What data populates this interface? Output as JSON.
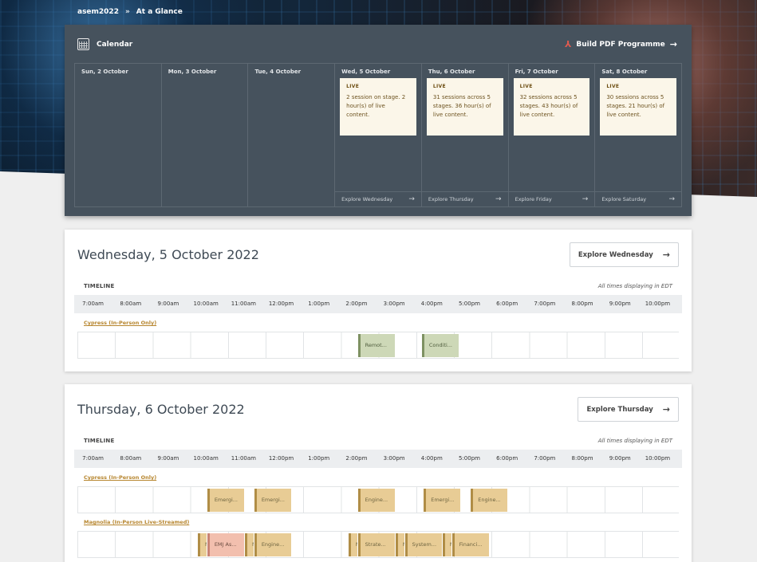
{
  "breadcrumb": {
    "root": "asem2022",
    "separator": "»",
    "current": "At a Glance"
  },
  "calendar": {
    "title": "Calendar",
    "pdf_button": "Build PDF Programme",
    "days": [
      {
        "label": "Sun, 2 October",
        "live": "",
        "desc": "",
        "explore": ""
      },
      {
        "label": "Mon, 3 October",
        "live": "",
        "desc": "",
        "explore": ""
      },
      {
        "label": "Tue, 4 October",
        "live": "",
        "desc": "",
        "explore": ""
      },
      {
        "label": "Wed, 5 October",
        "live": "LIVE",
        "desc": "2 session on stage. 2 hour(s) of live content.",
        "explore": "Explore Wednesday"
      },
      {
        "label": "Thu, 6 October",
        "live": "LIVE",
        "desc": "31 sessions across 5 stages. 36 hour(s) of live content.",
        "explore": "Explore Thursday"
      },
      {
        "label": "Fri, 7 October",
        "live": "LIVE",
        "desc": "32 sessions across 5 stages. 43 hour(s) of live content.",
        "explore": "Explore Friday"
      },
      {
        "label": "Sat, 8 October",
        "live": "LIVE",
        "desc": "30 sessions across 5 stages. 21 hour(s) of live content.",
        "explore": "Explore Saturday"
      }
    ]
  },
  "hours": [
    "7:00am",
    "8:00am",
    "9:00am",
    "10:00am",
    "11:00am",
    "12:00pm",
    "1:00pm",
    "2:00pm",
    "3:00pm",
    "4:00pm",
    "5:00pm",
    "6:00pm",
    "7:00pm",
    "8:00pm",
    "9:00pm",
    "10:00pm"
  ],
  "timeline_label": "TIMELINE",
  "timezone_note": "All times displaying in EDT",
  "wednesday": {
    "title": "Wednesday, 5 October 2022",
    "explore_button": "Explore Wednesday",
    "stages": [
      {
        "name": "Cypress (In-Person Only)",
        "sessions": [
          {
            "label": "Remot...",
            "start_hour": 14.0,
            "end_hour": 15.0,
            "kind": "green"
          },
          {
            "label": "Conditi...",
            "start_hour": 15.7,
            "end_hour": 16.7,
            "kind": "green"
          }
        ]
      }
    ]
  },
  "thursday": {
    "title": "Thursday, 6 October 2022",
    "explore_button": "Explore Thursday",
    "stages": [
      {
        "name": "Cypress (In-Person Only)",
        "sessions": [
          {
            "label": "Emergi...",
            "start_hour": 10.0,
            "end_hour": 11.0,
            "kind": "tan"
          },
          {
            "label": "Emergi...",
            "start_hour": 11.25,
            "end_hour": 12.25,
            "kind": "tan"
          },
          {
            "label": "Engine...",
            "start_hour": 14.0,
            "end_hour": 15.0,
            "kind": "tan"
          },
          {
            "label": "Emergi...",
            "start_hour": 15.75,
            "end_hour": 16.75,
            "kind": "tan"
          },
          {
            "label": "Engine...",
            "start_hour": 17.0,
            "end_hour": 18.0,
            "kind": "tan"
          }
        ]
      },
      {
        "name": "Magnolia (In-Person Live-Streamed)",
        "sessions": [
          {
            "label": "M",
            "start_hour": 9.75,
            "end_hour": 10.0,
            "kind": "tan"
          },
          {
            "label": "EMJ As...",
            "start_hour": 10.0,
            "end_hour": 11.0,
            "kind": "pink"
          },
          {
            "label": "M",
            "start_hour": 11.0,
            "end_hour": 11.25,
            "kind": "tan"
          },
          {
            "label": "Engine...",
            "start_hour": 11.25,
            "end_hour": 12.25,
            "kind": "tan"
          },
          {
            "label": "M",
            "start_hour": 13.75,
            "end_hour": 14.0,
            "kind": "tan"
          },
          {
            "label": "Strate...",
            "start_hour": 14.0,
            "end_hour": 15.0,
            "kind": "tan"
          },
          {
            "label": "M",
            "start_hour": 15.0,
            "end_hour": 15.25,
            "kind": "tan"
          },
          {
            "label": "System...",
            "start_hour": 15.25,
            "end_hour": 16.25,
            "kind": "tan"
          },
          {
            "label": "M",
            "start_hour": 16.25,
            "end_hour": 16.5,
            "kind": "tan"
          },
          {
            "label": "Financi...",
            "start_hour": 16.5,
            "end_hour": 17.5,
            "kind": "tan"
          }
        ]
      }
    ]
  }
}
